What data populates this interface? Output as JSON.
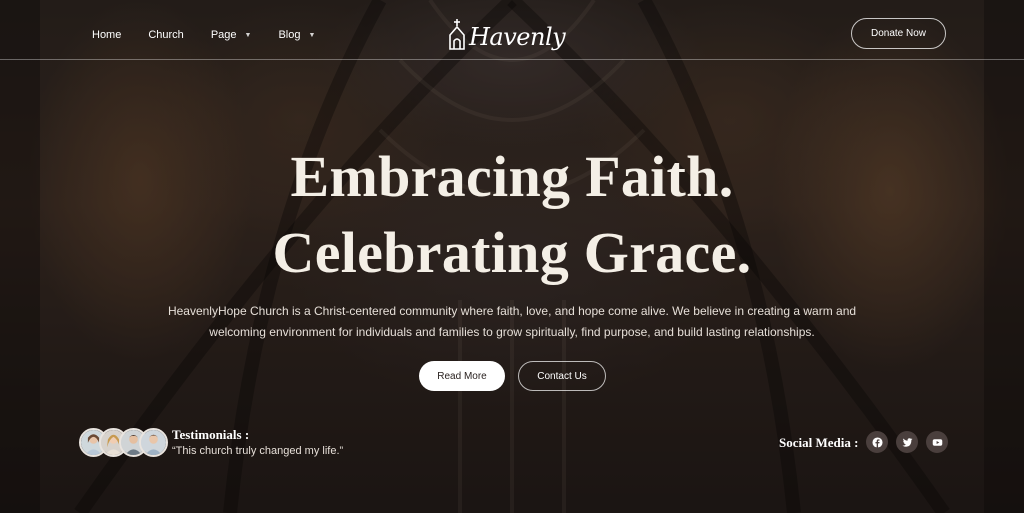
{
  "nav": {
    "items": [
      {
        "label": "Home",
        "has_dropdown": false
      },
      {
        "label": "Church",
        "has_dropdown": false
      },
      {
        "label": "Page",
        "has_dropdown": true
      },
      {
        "label": "Blog",
        "has_dropdown": true
      }
    ]
  },
  "logo": {
    "text": "Havenly",
    "icon": "church-icon"
  },
  "header": {
    "donate_label": "Donate Now"
  },
  "hero": {
    "title_line1": "Embracing Faith.",
    "title_line2": "Celebrating Grace.",
    "description_line1": "HeavenlyHope Church is a Christ-centered community where faith, love, and hope come alive. We believe in creating a warm and",
    "description_line2": "welcoming environment for individuals and families to grow spiritually, find purpose, and build lasting relationships.",
    "read_more_label": "Read More",
    "contact_label": "Contact Us"
  },
  "testimonials": {
    "title": "Testimonials :",
    "quote": "“This church truly changed my life.”"
  },
  "social": {
    "label": "Social Media :",
    "icons": [
      "facebook-icon",
      "twitter-icon",
      "youtube-icon"
    ]
  },
  "colors": {
    "title_text": "#f4efe6",
    "social_bg": "#4a3f3d",
    "button_light": "#ffffff"
  }
}
